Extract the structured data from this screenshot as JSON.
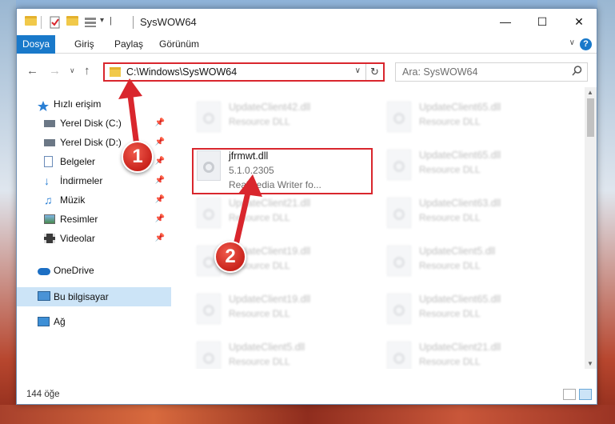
{
  "window": {
    "title": "SysWOW64",
    "quick_access_dropdown": "▾"
  },
  "ribbon": {
    "tabs": [
      "Dosya",
      "Giriş",
      "Paylaş",
      "Görünüm"
    ],
    "help": "?"
  },
  "address_bar": {
    "path": "C:\\Windows\\SysWOW64",
    "refresh": "↻"
  },
  "search": {
    "placeholder": "Ara: SysWOW64"
  },
  "nav_pane": {
    "items": [
      {
        "label": "Hızlı erişim",
        "icon": "star-icon",
        "pinned": false
      },
      {
        "label": "Yerel Disk (C:)",
        "icon": "drive-icon",
        "pinned": true
      },
      {
        "label": "Yerel Disk (D:)",
        "icon": "drive-icon",
        "pinned": true
      },
      {
        "label": "Belgeler",
        "icon": "documents-icon",
        "pinned": true
      },
      {
        "label": "İndirmeler",
        "icon": "download-icon",
        "pinned": true
      },
      {
        "label": "Müzik",
        "icon": "music-icon",
        "pinned": true
      },
      {
        "label": "Resimler",
        "icon": "pictures-icon",
        "pinned": true
      },
      {
        "label": "Videolar",
        "icon": "videos-icon",
        "pinned": true
      },
      {
        "label": "OneDrive",
        "icon": "cloud-icon",
        "pinned": false
      },
      {
        "label": "Bu bilgisayar",
        "icon": "computer-icon",
        "pinned": false,
        "selected": true
      },
      {
        "label": "Ağ",
        "icon": "network-icon",
        "pinned": false
      }
    ]
  },
  "files": {
    "highlighted": {
      "name": "jfrmwt.dll",
      "version": "5.1.0.2305",
      "description": "RealMedia Writer fo..."
    },
    "left_column": [
      {
        "name": "UpdateClient42.dll",
        "type": "Resource DLL"
      },
      {
        "name": "UpdateClient21.dll",
        "type": "Resource DLL"
      },
      {
        "name": "UpdateClient19.dll",
        "type": "Resource DLL"
      },
      {
        "name": "UpdateClient19.dll",
        "type": "Resource DLL"
      },
      {
        "name": "UpdateClient5.dll",
        "type": "Resource DLL"
      }
    ],
    "right_column": [
      {
        "name": "UpdateClient65.dll",
        "type": "Resource DLL"
      },
      {
        "name": "UpdateClient65.dll",
        "type": "Resource DLL"
      },
      {
        "name": "UpdateClient63.dll",
        "type": "Resource DLL"
      },
      {
        "name": "UpdateClient5.dll",
        "type": "Resource DLL"
      },
      {
        "name": "UpdateClient65.dll",
        "type": "Resource DLL"
      },
      {
        "name": "UpdateClient21.dll",
        "type": "Resource DLL"
      }
    ]
  },
  "status_bar": {
    "item_count": "144 öğe"
  },
  "annotations": {
    "step1": "1",
    "step2": "2",
    "color": "#d9262d"
  }
}
